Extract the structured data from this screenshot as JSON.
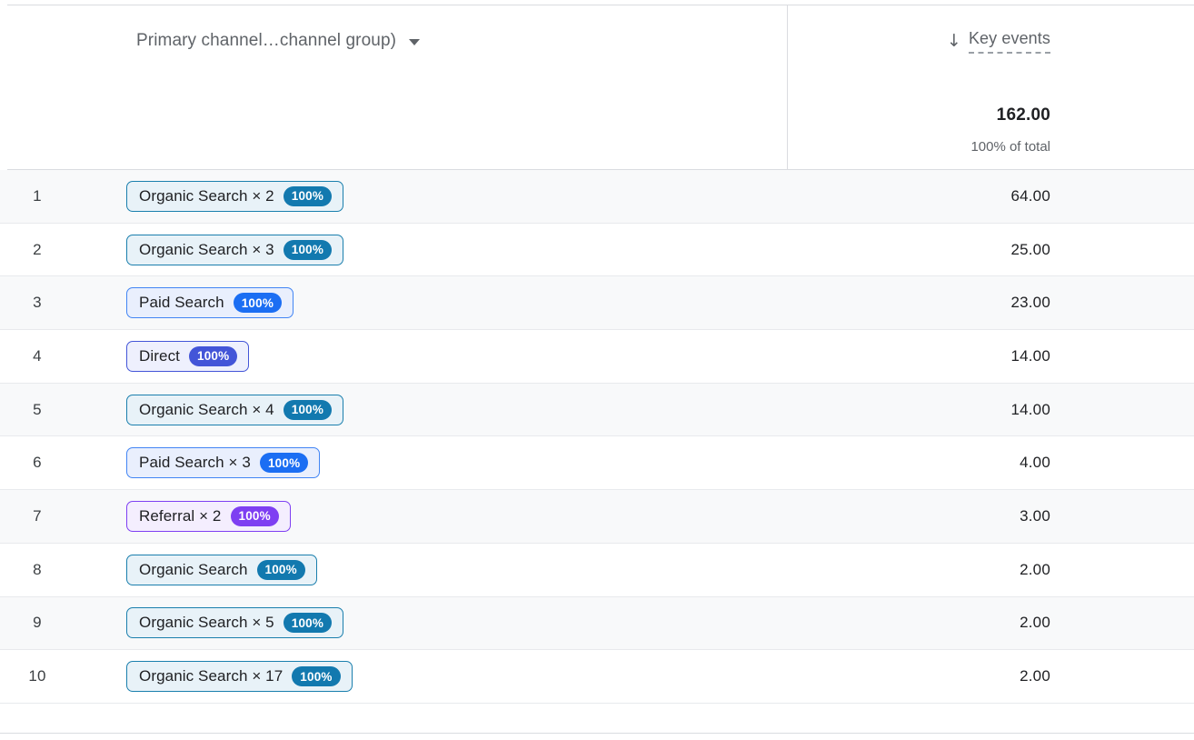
{
  "table": {
    "dimension_header": {
      "label": "Primary channel…channel group)",
      "caret_icon": "chevron-down-icon"
    },
    "metric_header": {
      "sort_arrow": "↓",
      "sort_icon": "sort-descending-icon",
      "label": "Key events",
      "total": "162.00",
      "total_percent": "100% of total"
    },
    "colors": {
      "organic_border": "#1a7fad",
      "organic_badge": "#1279af",
      "organic_bg": "#e8f2f8",
      "paid_border": "#4285f4",
      "paid_badge": "#1b6ef3",
      "paid_bg": "#e9effd",
      "direct_border": "#4355d8",
      "direct_badge": "#4355d8",
      "direct_bg": "#eef0fd",
      "referral_border": "#7e3ff2",
      "referral_badge": "#7e3ff2",
      "referral_bg": "#f4eefe",
      "row_stripe": "#f8f9fa",
      "divider": "#dadce0"
    },
    "rows": [
      {
        "index": "1",
        "chip_label": "Organic Search × 2",
        "chip_badge": "100%",
        "chip_type": "organic",
        "value": "64.00"
      },
      {
        "index": "2",
        "chip_label": "Organic Search × 3",
        "chip_badge": "100%",
        "chip_type": "organic",
        "value": "25.00"
      },
      {
        "index": "3",
        "chip_label": "Paid Search",
        "chip_badge": "100%",
        "chip_type": "paid",
        "value": "23.00"
      },
      {
        "index": "4",
        "chip_label": "Direct",
        "chip_badge": "100%",
        "chip_type": "direct",
        "value": "14.00"
      },
      {
        "index": "5",
        "chip_label": "Organic Search × 4",
        "chip_badge": "100%",
        "chip_type": "organic",
        "value": "14.00"
      },
      {
        "index": "6",
        "chip_label": "Paid Search × 3",
        "chip_badge": "100%",
        "chip_type": "paid",
        "value": "4.00"
      },
      {
        "index": "7",
        "chip_label": "Referral × 2",
        "chip_badge": "100%",
        "chip_type": "referral",
        "value": "3.00"
      },
      {
        "index": "8",
        "chip_label": "Organic Search",
        "chip_badge": "100%",
        "chip_type": "organic",
        "value": "2.00"
      },
      {
        "index": "9",
        "chip_label": "Organic Search × 5",
        "chip_badge": "100%",
        "chip_type": "organic",
        "value": "2.00"
      },
      {
        "index": "10",
        "chip_label": "Organic Search × 17",
        "chip_badge": "100%",
        "chip_type": "organic",
        "value": "2.00"
      }
    ]
  }
}
